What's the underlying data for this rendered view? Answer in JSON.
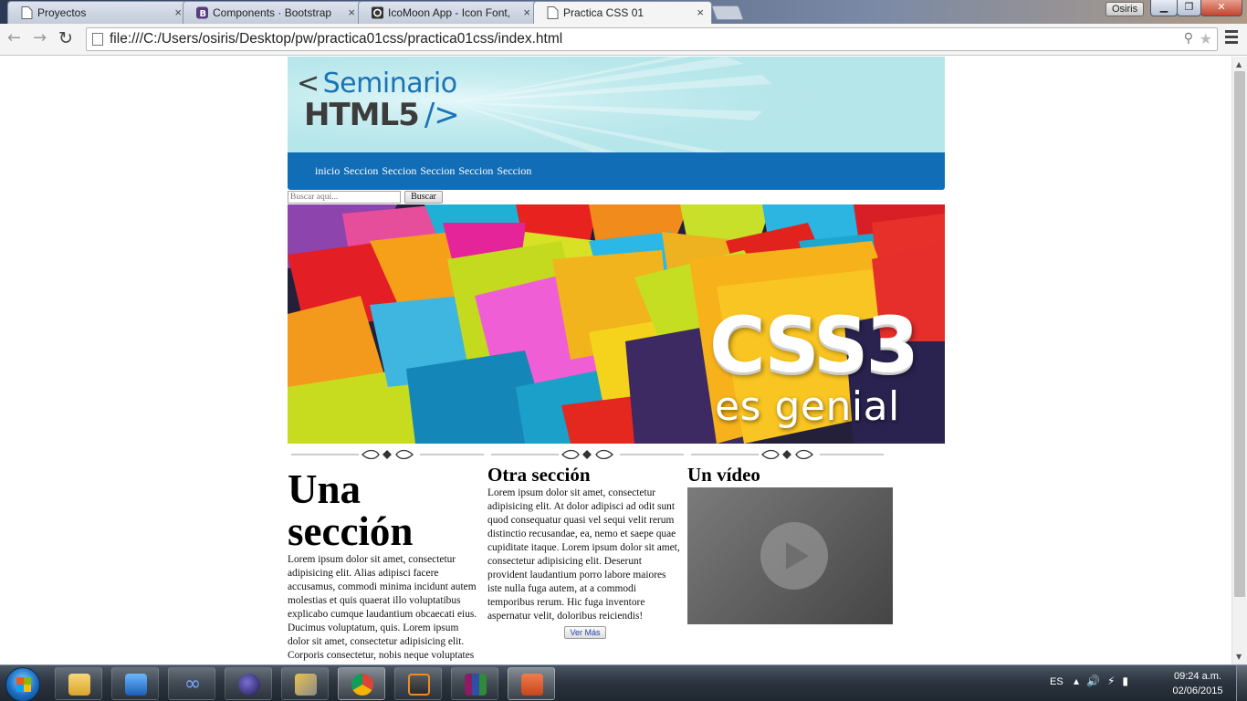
{
  "browser": {
    "tabs": [
      {
        "title": "Proyectos",
        "icon": "page-icon"
      },
      {
        "title": "Components · Bootstrap",
        "icon": "bootstrap-icon"
      },
      {
        "title": "IcoMoon App - Icon Font,",
        "icon": "icomoon-icon"
      },
      {
        "title": "Practica CSS 01",
        "icon": "page-icon",
        "active": true
      }
    ],
    "tab_close": "×",
    "user": "Osiris",
    "url": "file:///C:/Users/osiris/Desktop/pw/practica01css/practica01css/index.html"
  },
  "page": {
    "logo": {
      "line1_bracket": "<",
      "line1": "Seminario",
      "line2": "HTML5",
      "line2_bracket": "/>"
    },
    "nav": {
      "items": [
        "inicio",
        "Seccion",
        "Seccion",
        "Seccion",
        "Seccion",
        "Seccion"
      ]
    },
    "search": {
      "placeholder": "Buscar aquí...",
      "button": "Buscar"
    },
    "hero": {
      "title": "CSS3",
      "subtitle": "es genial"
    },
    "sections": [
      {
        "heading": "Una sección",
        "body": "Lorem ipsum dolor sit amet, consectetur adipisicing elit. Alias adipisci facere accusamus, commodi minima incidunt autem molestias et quis quaerat illo voluptatibus explicabo cumque laudantium obcaecati eius. Ducimus voluptatum, quis. Lorem ipsum dolor sit amet, consectetur adipisicing elit. Corporis consectetur, nobis neque voluptates"
      },
      {
        "heading": "Otra sección",
        "body": "Lorem ipsum dolor sit amet, consectetur adipisicing elit. At dolor adipisci ad odit sunt quod consequatur quasi vel sequi velit rerum distinctio recusandae, ea, nemo et saepe quae cupiditate itaque. Lorem ipsum dolor sit amet, consectetur adipisicing elit. Deserunt provident laudantium porro labore maiores iste nulla fuga autem, at a commodi temporibus rerum. Hic fuga inventore aspernatur velit, doloribus reiciendis!",
        "button": "Ver Más"
      },
      {
        "heading": "Un vídeo"
      }
    ]
  },
  "taskbar": {
    "lang": "ES",
    "time": "09:24 a.m.",
    "date": "02/06/2015",
    "apps": [
      "file-explorer-icon",
      "media-player-icon",
      "infinity-app-icon",
      "eclipse-icon",
      "tools-icon",
      "chrome-icon",
      "sublime-text-icon",
      "winrar-icon",
      "powerpoint-icon"
    ]
  },
  "colors": {
    "nav_bg": "#116db5",
    "banner_bg": "#b5e6ea",
    "logo_blue": "#1b73b6"
  }
}
